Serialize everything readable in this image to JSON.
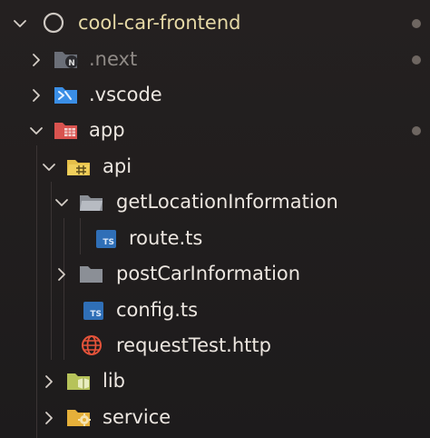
{
  "explorer": {
    "root": {
      "label": "cool-car-frontend"
    },
    "items": [
      {
        "label": ".next",
        "icon": "nextjs-folder-icon"
      },
      {
        "label": ".vscode",
        "icon": "vscode-folder-icon"
      },
      {
        "label": "app",
        "icon": "app-folder-icon"
      },
      {
        "label": "api",
        "icon": "api-folder-icon"
      },
      {
        "label": "getLocationInformation",
        "icon": "folder-open-icon"
      },
      {
        "label": "route.ts",
        "icon": "typescript-file-icon",
        "badge": "TS"
      },
      {
        "label": "postCarInformation",
        "icon": "folder-icon"
      },
      {
        "label": "config.ts",
        "icon": "typescript-file-icon",
        "badge": "TS"
      },
      {
        "label": "requestTest.http",
        "icon": "globe-icon"
      },
      {
        "label": "lib",
        "icon": "lib-folder-icon"
      },
      {
        "label": "service",
        "icon": "service-folder-icon"
      }
    ]
  },
  "colors": {
    "background": "#1f1d1d",
    "text": "#ece6e0",
    "root_text": "#e6d9a6",
    "dim_text": "#8f8a86",
    "folder_yellow": "#e6c04a",
    "app_red": "#d9534f",
    "vscode_blue": "#3a8ee6",
    "ts_blue": "#2f6fb7",
    "globe_red": "#e5533a"
  }
}
